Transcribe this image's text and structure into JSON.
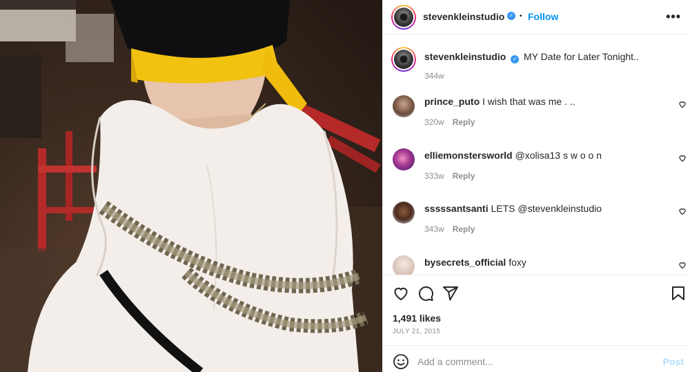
{
  "post": {
    "author": "stevenkleinstudio",
    "verified": true,
    "separator": "•",
    "follow_label": "Follow",
    "more_label": "•••",
    "caption": "MY Date for Later Tonight..",
    "caption_age": "344w"
  },
  "comments": [
    {
      "username": "prince_puto",
      "text": "I wish that was me . ..",
      "age": "320w",
      "reply_label": "Reply"
    },
    {
      "username": "elliemonstersworld",
      "text": "@xolisa13 s w o o n",
      "age": "333w",
      "reply_label": "Reply"
    },
    {
      "username": "sssssantsanti",
      "text": "LETS @stevenkleinstudio",
      "age": "343w",
      "reply_label": "Reply"
    },
    {
      "username": "bysecrets_official",
      "text": "foxy",
      "age": "",
      "reply_label": ""
    }
  ],
  "actions": {
    "likes": "1,491 likes",
    "date": "JULY 21, 2015",
    "icons": [
      "heart-icon",
      "comment-icon",
      "share-icon",
      "bookmark-icon"
    ]
  },
  "compose": {
    "placeholder": "Add a comment...",
    "post_label": "Post"
  },
  "colors": {
    "accent": "#0095f6",
    "verified": "#3897f0",
    "muted": "#8e8e8e",
    "post_disabled": "#b2dffc"
  }
}
